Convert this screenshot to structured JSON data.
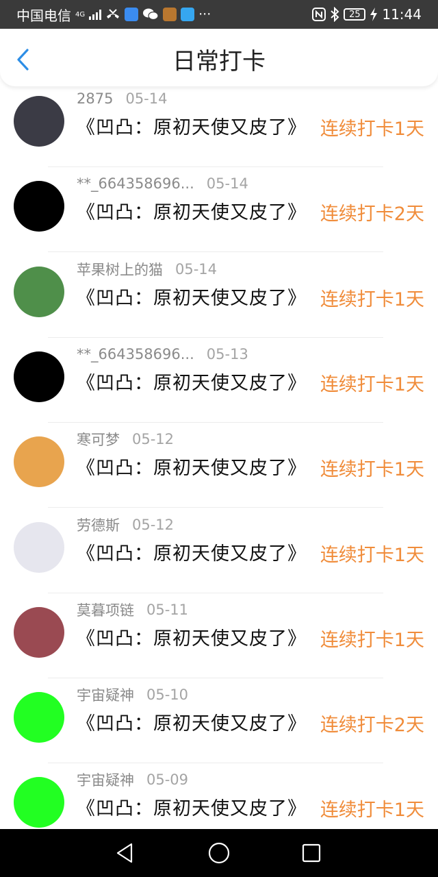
{
  "status_bar": {
    "carrier": "中国电信",
    "network": "4G",
    "time": "11:44",
    "battery": "25",
    "more": "···"
  },
  "header": {
    "title": "日常打卡"
  },
  "records": [
    {
      "name": "2875",
      "date": "05-14",
      "book": "《凹凸：原初天使又皮了》",
      "streak": "连续打卡1天",
      "avatar_color": "#3b3b45"
    },
    {
      "name": "**_664358696...",
      "date": "05-14",
      "book": "《凹凸：原初天使又皮了》",
      "streak": "连续打卡2天",
      "avatar_color": "#000000"
    },
    {
      "name": "苹果树上的猫",
      "date": "05-14",
      "book": "《凹凸：原初天使又皮了》",
      "streak": "连续打卡1天",
      "avatar_color": "#4f8f4a"
    },
    {
      "name": "**_664358696...",
      "date": "05-13",
      "book": "《凹凸：原初天使又皮了》",
      "streak": "连续打卡1天",
      "avatar_color": "#000000"
    },
    {
      "name": "寒可梦",
      "date": "05-12",
      "book": "《凹凸：原初天使又皮了》",
      "streak": "连续打卡1天",
      "avatar_color": "#e8a44e"
    },
    {
      "name": "劳德斯",
      "date": "05-12",
      "book": "《凹凸：原初天使又皮了》",
      "streak": "连续打卡1天",
      "avatar_color": "#e6e6ee"
    },
    {
      "name": "莫暮项链",
      "date": "05-11",
      "book": "《凹凸：原初天使又皮了》",
      "streak": "连续打卡1天",
      "avatar_color": "#9a4a52"
    },
    {
      "name": "宇宙疑神",
      "date": "05-10",
      "book": "《凹凸：原初天使又皮了》",
      "streak": "连续打卡2天",
      "avatar_color": "#22ff22"
    },
    {
      "name": "宇宙疑神",
      "date": "05-09",
      "book": "《凹凸：原初天使又皮了》",
      "streak": "连续打卡1天",
      "avatar_color": "#22ff22"
    }
  ],
  "colors": {
    "accent_orange": "#f08c3a",
    "back_blue": "#2d8ee6"
  }
}
